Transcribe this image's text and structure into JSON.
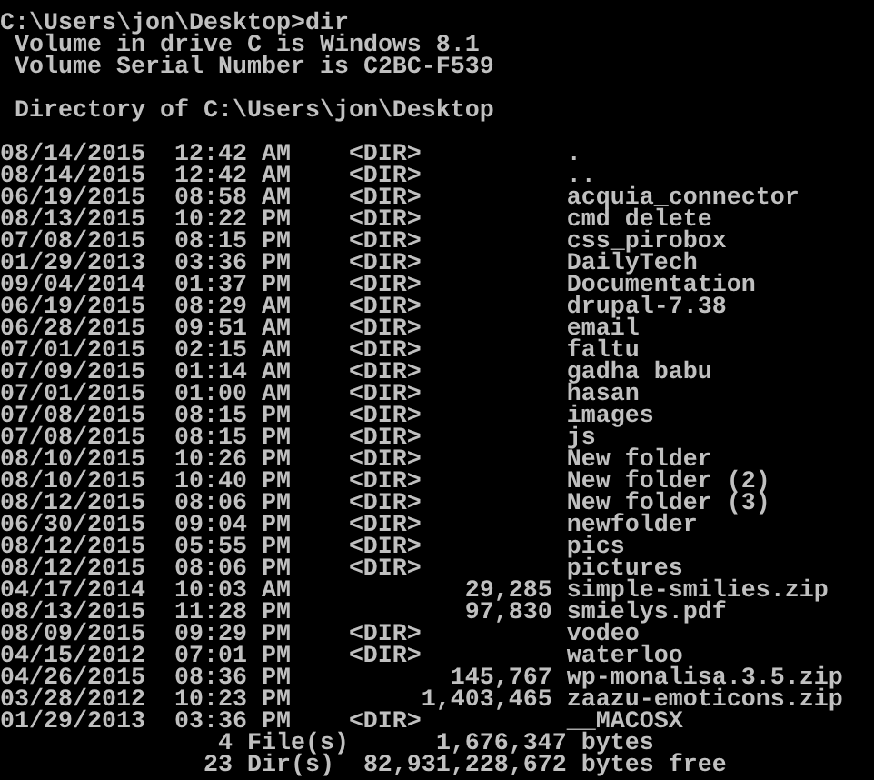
{
  "console": {
    "prompt": "C:\\Users\\jon\\Desktop>dir",
    "volume_lines": [
      "Volume in drive C is Windows 8.1",
      "Volume Serial Number is C2BC-F539"
    ],
    "directory_line": "Directory of C:\\Users\\jon\\Desktop",
    "entries": [
      {
        "kind": "dir",
        "date": "08/14/2015",
        "time": "12:42 AM",
        "column_3": "<DIR>",
        "name": "."
      },
      {
        "kind": "dir",
        "date": "08/14/2015",
        "time": "12:42 AM",
        "column_3": "<DIR>",
        "name": ".."
      },
      {
        "kind": "dir",
        "date": "06/19/2015",
        "time": "08:58 AM",
        "column_3": "<DIR>",
        "name": "acquia_connector"
      },
      {
        "kind": "dir",
        "date": "08/13/2015",
        "time": "10:22 PM",
        "column_3": "<DIR>",
        "name": "cmd delete"
      },
      {
        "kind": "dir",
        "date": "07/08/2015",
        "time": "08:15 PM",
        "column_3": "<DIR>",
        "name": "css_pirobox"
      },
      {
        "kind": "dir",
        "date": "01/29/2013",
        "time": "03:36 PM",
        "column_3": "<DIR>",
        "name": "DailyTech"
      },
      {
        "kind": "dir",
        "date": "09/04/2014",
        "time": "01:37 PM",
        "column_3": "<DIR>",
        "name": "Documentation"
      },
      {
        "kind": "dir",
        "date": "06/19/2015",
        "time": "08:29 AM",
        "column_3": "<DIR>",
        "name": "drupal-7.38"
      },
      {
        "kind": "dir",
        "date": "06/28/2015",
        "time": "09:51 AM",
        "column_3": "<DIR>",
        "name": "email"
      },
      {
        "kind": "dir",
        "date": "07/01/2015",
        "time": "02:15 AM",
        "column_3": "<DIR>",
        "name": "faltu"
      },
      {
        "kind": "dir",
        "date": "07/09/2015",
        "time": "01:14 AM",
        "column_3": "<DIR>",
        "name": "gadha babu"
      },
      {
        "kind": "dir",
        "date": "07/01/2015",
        "time": "01:00 AM",
        "column_3": "<DIR>",
        "name": "hasan"
      },
      {
        "kind": "dir",
        "date": "07/08/2015",
        "time": "08:15 PM",
        "column_3": "<DIR>",
        "name": "images"
      },
      {
        "kind": "dir",
        "date": "07/08/2015",
        "time": "08:15 PM",
        "column_3": "<DIR>",
        "name": "js"
      },
      {
        "kind": "dir",
        "date": "08/10/2015",
        "time": "10:26 PM",
        "column_3": "<DIR>",
        "name": "New folder"
      },
      {
        "kind": "dir",
        "date": "08/10/2015",
        "time": "10:40 PM",
        "column_3": "<DIR>",
        "name": "New folder (2)"
      },
      {
        "kind": "dir",
        "date": "08/12/2015",
        "time": "08:06 PM",
        "column_3": "<DIR>",
        "name": "New folder (3)"
      },
      {
        "kind": "dir",
        "date": "06/30/2015",
        "time": "09:04 PM",
        "column_3": "<DIR>",
        "name": "newfolder"
      },
      {
        "kind": "dir",
        "date": "08/12/2015",
        "time": "05:55 PM",
        "column_3": "<DIR>",
        "name": "pics"
      },
      {
        "kind": "dir",
        "date": "08/12/2015",
        "time": "08:06 PM",
        "column_3": "<DIR>",
        "name": "pictures"
      },
      {
        "kind": "file",
        "date": "04/17/2014",
        "time": "10:03 AM",
        "column_3": "29,285",
        "name": "simple-smilies.zip"
      },
      {
        "kind": "file",
        "date": "08/13/2015",
        "time": "11:28 PM",
        "column_3": "97,830",
        "name": "smielys.pdf"
      },
      {
        "kind": "dir",
        "date": "08/09/2015",
        "time": "09:29 PM",
        "column_3": "<DIR>",
        "name": "vodeo"
      },
      {
        "kind": "dir",
        "date": "04/15/2012",
        "time": "07:01 PM",
        "column_3": "<DIR>",
        "name": "waterloo"
      },
      {
        "kind": "file",
        "date": "04/26/2015",
        "time": "08:36 PM",
        "column_3": "145,767",
        "name": "wp-monalisa.3.5.zip"
      },
      {
        "kind": "file",
        "date": "03/28/2012",
        "time": "10:23 PM",
        "column_3": "1,403,465",
        "name": "zaazu-emoticons.zip"
      },
      {
        "kind": "dir",
        "date": "01/29/2013",
        "time": "03:36 PM",
        "column_3": "<DIR>",
        "name": "__MACOSX"
      }
    ],
    "summary": [
      {
        "count": "4",
        "label": "File(s)",
        "amount": "1,676,347",
        "unit": "bytes"
      },
      {
        "count": "23",
        "label": "Dir(s)",
        "amount": "82,931,228,672",
        "unit": "bytes free"
      }
    ]
  }
}
